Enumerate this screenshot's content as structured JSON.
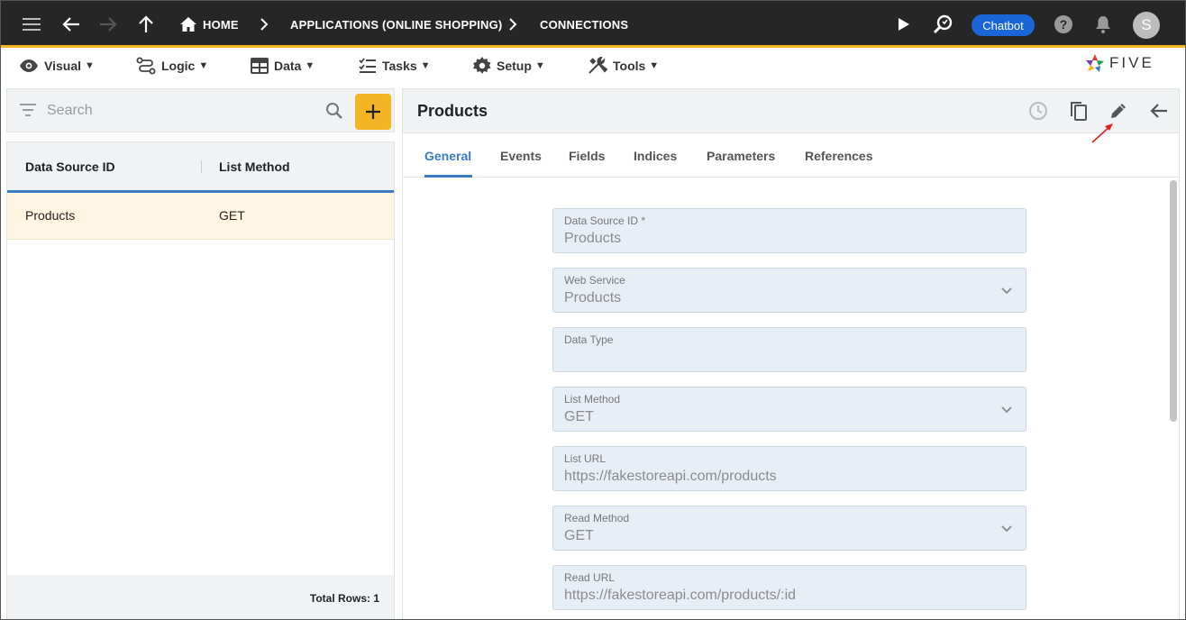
{
  "topbar": {
    "breadcrumbs": [
      "HOME",
      "APPLICATIONS (ONLINE SHOPPING)",
      "CONNECTIONS"
    ],
    "chatbot_label": "Chatbot",
    "avatar_letter": "S"
  },
  "menubar": {
    "items": [
      {
        "label": "Visual",
        "icon": "eye-icon"
      },
      {
        "label": "Logic",
        "icon": "logic-icon"
      },
      {
        "label": "Data",
        "icon": "table-icon"
      },
      {
        "label": "Tasks",
        "icon": "tasks-icon"
      },
      {
        "label": "Setup",
        "icon": "gear-icon"
      },
      {
        "label": "Tools",
        "icon": "tools-icon"
      }
    ],
    "caret": "▼",
    "logo_text": "FIVE"
  },
  "left": {
    "search_placeholder": "Search",
    "columns": [
      "Data Source ID",
      "List Method"
    ],
    "rows": [
      {
        "data_source_id": "Products",
        "list_method": "GET"
      }
    ],
    "total_rows": "Total Rows: 1"
  },
  "right": {
    "title": "Products",
    "tabs": [
      "General",
      "Events",
      "Fields",
      "Indices",
      "Parameters",
      "References"
    ],
    "active_tab": "General",
    "fields": [
      {
        "label": "Data Source ID *",
        "value": "Products",
        "dropdown": false
      },
      {
        "label": "Web Service",
        "value": "Products",
        "dropdown": true
      },
      {
        "label": "Data Type",
        "value": "",
        "dropdown": false
      },
      {
        "label": "List Method",
        "value": "GET",
        "dropdown": true
      },
      {
        "label": "List URL",
        "value": "https://fakestoreapi.com/products",
        "dropdown": false
      },
      {
        "label": "Read Method",
        "value": "GET",
        "dropdown": true
      },
      {
        "label": "Read URL",
        "value": "https://fakestoreapi.com/products/:id",
        "dropdown": false
      }
    ]
  },
  "colors": {
    "accent_yellow": "#f5b424",
    "accent_blue": "#3a7cc4",
    "chatbot_blue": "#1a66d8",
    "topbar_bg": "#262626"
  }
}
